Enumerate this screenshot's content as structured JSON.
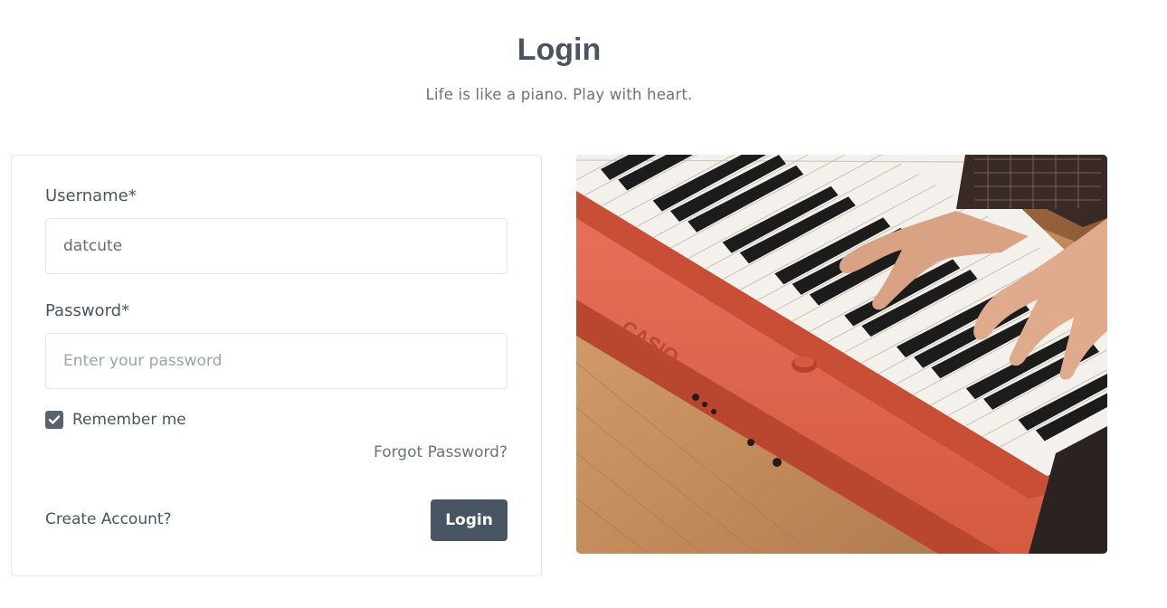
{
  "header": {
    "title": "Login",
    "subtitle": "Life is like a piano. Play with heart."
  },
  "form": {
    "username": {
      "label": "Username*",
      "value": "datcute",
      "placeholder": ""
    },
    "password": {
      "label": "Password*",
      "value": "",
      "placeholder": "Enter your password"
    },
    "remember": {
      "label": "Remember me",
      "checked": true
    },
    "forgot_label": "Forgot Password?",
    "create_account_label": "Create Account?",
    "submit_label": "Login"
  },
  "hero": {
    "brand_on_keyboard": "CASIO",
    "alt": "hands playing an orange keyboard"
  },
  "colors": {
    "primary": "#4a5563",
    "border": "#e7e9ec",
    "muted_text": "#6b7280",
    "keyboard_orange": "#e2674e"
  }
}
